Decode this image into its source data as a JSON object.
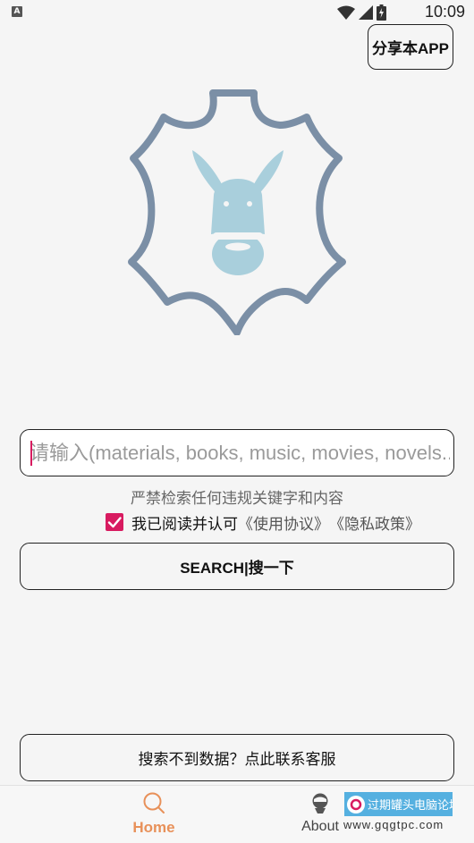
{
  "status_bar": {
    "time": "10:09",
    "notification_icon": "A",
    "icons": [
      "wifi-icon",
      "signal-icon",
      "battery-charging-icon"
    ]
  },
  "share_button": {
    "label": "分享本APP"
  },
  "logo": {
    "icon": "donkey-leather-icon",
    "colors": {
      "outline": "#7b8fa6",
      "donkey": "#a9cfdc"
    }
  },
  "search": {
    "placeholder": "请输入(materials, books, music, movies, novels...)",
    "value": ""
  },
  "warning_text": "严禁检索任何违规关键字和内容",
  "agreement": {
    "checked": true,
    "label": "我已阅读并认可",
    "terms_link": "《使用协议》",
    "privacy_link": "《隐私政策》"
  },
  "search_button": {
    "label": "SEARCH|搜一下"
  },
  "contact_button": {
    "label": "搜索不到数据？点此联系客服"
  },
  "bottom_nav": {
    "items": [
      {
        "label": "Home",
        "icon": "search-icon",
        "active": true
      },
      {
        "label": "About",
        "icon": "person-icon",
        "active": false
      }
    ]
  },
  "watermark": {
    "text": "过期罐头电脑论坛",
    "url": "www.gqgtpc.com"
  },
  "colors": {
    "accent": "#d81b60",
    "nav_active": "#e8915a",
    "background": "#f5f5f5"
  }
}
